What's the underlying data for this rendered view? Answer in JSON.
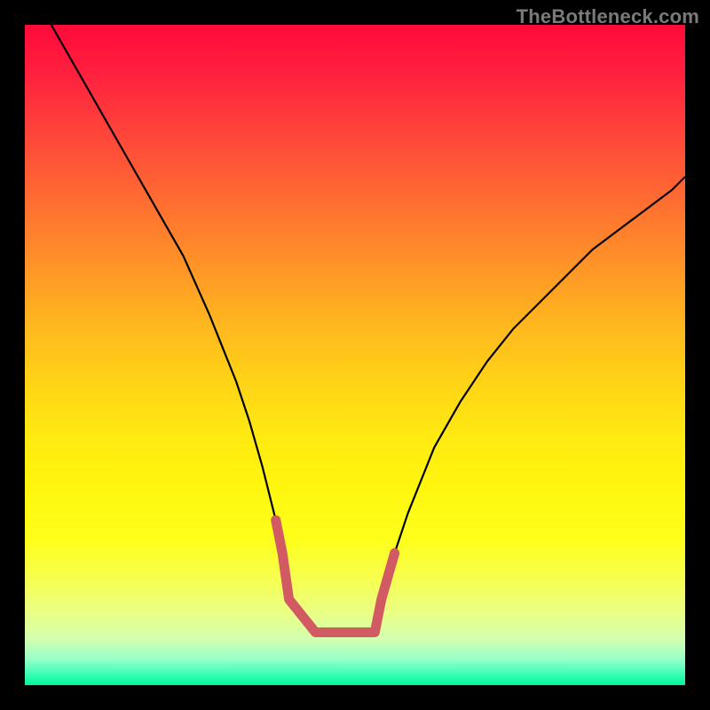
{
  "watermark": {
    "text": "TheBottleneck.com"
  },
  "chart_data": {
    "type": "line",
    "title": "",
    "xlabel": "",
    "ylabel": "",
    "xlim": [
      0,
      100
    ],
    "ylim": [
      0,
      100
    ],
    "grid": false,
    "legend": false,
    "series": [
      {
        "name": "curve",
        "stroke": "#000000",
        "stroke_width": 2.2,
        "x": [
          4,
          8,
          12,
          16,
          20,
          24,
          28,
          30,
          32,
          34,
          36,
          38,
          39,
          40,
          44,
          50,
          53,
          54,
          56,
          58,
          60,
          62,
          66,
          70,
          74,
          78,
          82,
          86,
          90,
          94,
          98,
          100
        ],
        "y": [
          100,
          93,
          86,
          79,
          72,
          65,
          56,
          51,
          46,
          40,
          33,
          25,
          20,
          13,
          8,
          8,
          8,
          13,
          20,
          26,
          31,
          36,
          43,
          49,
          54,
          58,
          62,
          66,
          69,
          72,
          75,
          77
        ]
      },
      {
        "name": "bottom-highlight",
        "stroke": "#d15a63",
        "stroke_width": 11,
        "linecap": "round",
        "x": [
          38,
          39,
          40,
          44,
          50,
          53,
          54,
          56
        ],
        "y": [
          25,
          20,
          13,
          8,
          8,
          8,
          13,
          20
        ]
      }
    ],
    "gradient_stops": [
      {
        "pos": 0,
        "color": "#ff0a3a"
      },
      {
        "pos": 14,
        "color": "#ff3b3c"
      },
      {
        "pos": 30,
        "color": "#ff7a2e"
      },
      {
        "pos": 46,
        "color": "#ffb91e"
      },
      {
        "pos": 62,
        "color": "#ffe912"
      },
      {
        "pos": 78,
        "color": "#feff1c"
      },
      {
        "pos": 93,
        "color": "#d3ffb0"
      },
      {
        "pos": 100,
        "color": "#00f59b"
      }
    ]
  }
}
